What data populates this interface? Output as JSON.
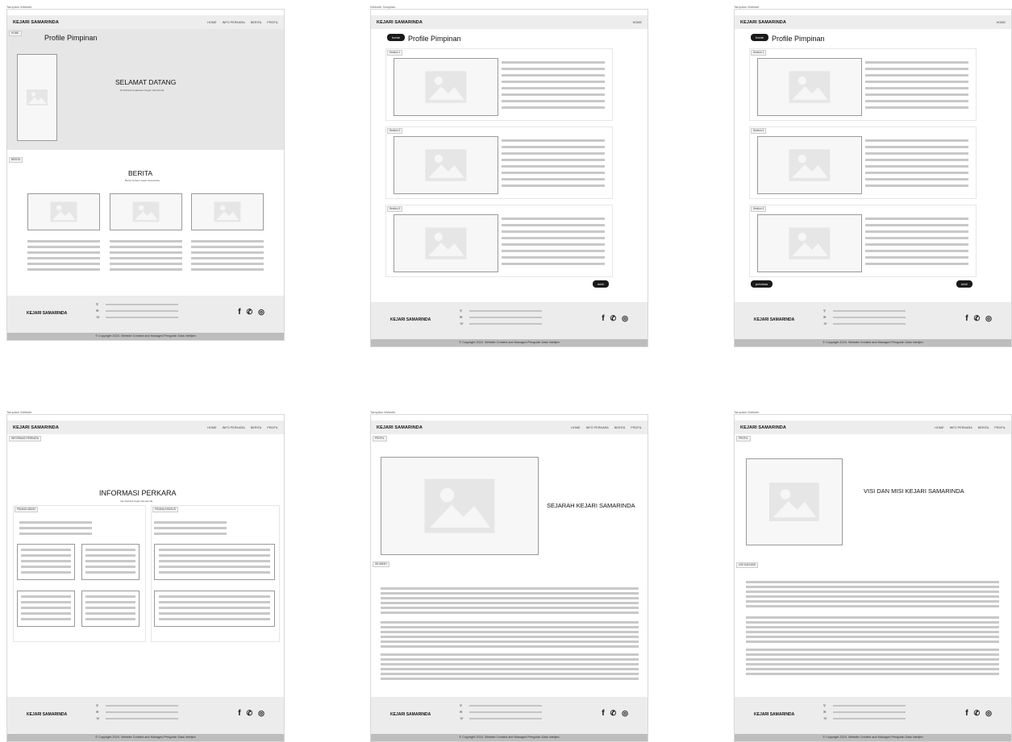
{
  "brand": "KEJARI SAMARINDA",
  "nav_full": [
    "HOME",
    "INFO PERKARA",
    "BERITA",
    "PROFIL"
  ],
  "nav_home_only": "HOME",
  "frame_title": "Tampilan Website",
  "frames_titles": [
    "Tampilan Website",
    "Website Tampilan",
    "Tampilan Website",
    "Tampilan Website",
    "Tampilan Website",
    "Tampilan Website"
  ],
  "home": {
    "tag": "HOME",
    "profile": "Profile Pimpinan",
    "welcome": "SELAMAT DATANG",
    "welcome_sub": "Di Website Kejaksaan Negeri Samarinda",
    "berita_tag": "BERITA",
    "berita": "BERITA",
    "berita_sub": "Berita Terbaru Kejari Samarinda"
  },
  "profile_page": {
    "home_pill": "home",
    "title": "Profile Pimpinan",
    "sections": [
      "Section 1",
      "Section 2",
      "Section 3"
    ],
    "next": "next",
    "previous": "previous"
  },
  "info": {
    "tag": "INFORMASI PERKARA",
    "title": "INFORMASI PERKARA",
    "sub": "Info Perkara Kejari Samarinda",
    "left_tag": "PIDANA UMUM",
    "right_tag": "PIDANA KHUSUS"
  },
  "sejarah": {
    "tag": "PROFIL",
    "title": "SEJARAH KEJARI SAMARINDA",
    "sub_tag": "SEJARAH"
  },
  "visi": {
    "tag": "PROFIL",
    "title": "VISI DAN MISI KEJARI SAMARINDA",
    "sub_tag": "VISI DAN MISI"
  },
  "footer": {
    "name": "KEJARI SAMARINDA",
    "copyright": "© Copyright 2024. Website Created and Managed Pengolah Data Intelijen",
    "icons": [
      "location-pin-icon",
      "email-icon",
      "phone-icon"
    ],
    "social": [
      "facebook-icon",
      "whatsapp-icon",
      "instagram-icon"
    ]
  }
}
